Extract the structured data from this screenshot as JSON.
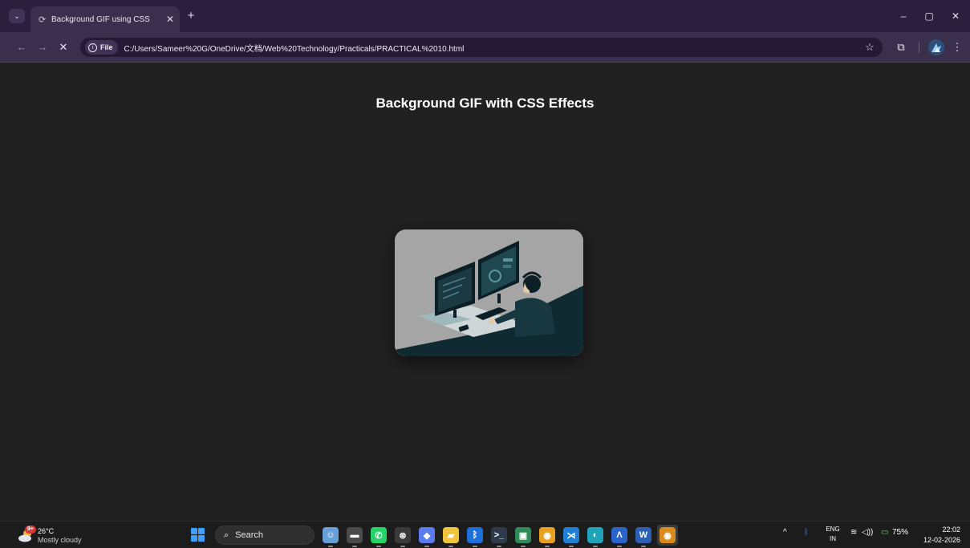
{
  "browser": {
    "tab_switcher_icon": "chevron-down-icon",
    "tab": {
      "title": "Background GIF using CSS",
      "favicon": "loading-icon"
    },
    "new_tab_symbol": "+",
    "window_controls": {
      "minimize": "–",
      "restore": "▢",
      "close": "✕"
    },
    "toolbar": {
      "back": "←",
      "forward": "→",
      "stop": "✕",
      "chip_label": "File",
      "url": "C:/Users/Sameer%20G/OneDrive/文档/Web%20Technology/Practicals/PRACTICAL%2010.html",
      "bookmark": "☆",
      "extensions": "⧉",
      "menu": "⋮"
    }
  },
  "page": {
    "heading": "Background GIF with CSS Effects",
    "gif_illustration": "person-at-dual-monitor-desk-illustration"
  },
  "taskbar": {
    "weather": {
      "badge": "9+",
      "temp": "26°C",
      "desc": "Mostly cloudy"
    },
    "search_label": "Search",
    "apps": [
      {
        "name": "copilot-people-app",
        "glyph": "☺",
        "color": "#6aa0d8"
      },
      {
        "name": "task-view-app",
        "glyph": "▬",
        "color": "#4a4a4a"
      },
      {
        "name": "whatsapp-app",
        "glyph": "✆",
        "color": "#25d366"
      },
      {
        "name": "chatgpt-app",
        "glyph": "⊛",
        "color": "#3a3a3a"
      },
      {
        "name": "copilot-app",
        "glyph": "◆",
        "color": "#5b7cf0"
      },
      {
        "name": "file-explorer-app",
        "glyph": "▰",
        "color": "#f2c33d"
      },
      {
        "name": "bluetooth-app",
        "glyph": "ᛒ",
        "color": "#1e6fd9"
      },
      {
        "name": "terminal-app",
        "glyph": ">_",
        "color": "#2d3a4a"
      },
      {
        "name": "photos-app",
        "glyph": "▣",
        "color": "#2e8b57"
      },
      {
        "name": "chrome-app",
        "glyph": "◉",
        "color": "#e8a020"
      },
      {
        "name": "vscode-app",
        "glyph": "⋊",
        "color": "#1f7fd6"
      },
      {
        "name": "edge-app",
        "glyph": "◐",
        "color": "#1fa3b8"
      },
      {
        "name": "vpn-app",
        "glyph": "Λ",
        "color": "#2a63c9"
      },
      {
        "name": "word-app",
        "glyph": "W",
        "color": "#2b5fb4"
      },
      {
        "name": "chrome-canary-app",
        "glyph": "◉",
        "color": "#d98c1c"
      }
    ],
    "tray": {
      "overflow": "^",
      "bluetooth": "ᛒ",
      "lang_top": "ENG",
      "lang_bottom": "IN",
      "wifi": "≋",
      "volume": "◁))",
      "battery": "75%",
      "time": "22:02",
      "date": "12-02-2026"
    }
  }
}
